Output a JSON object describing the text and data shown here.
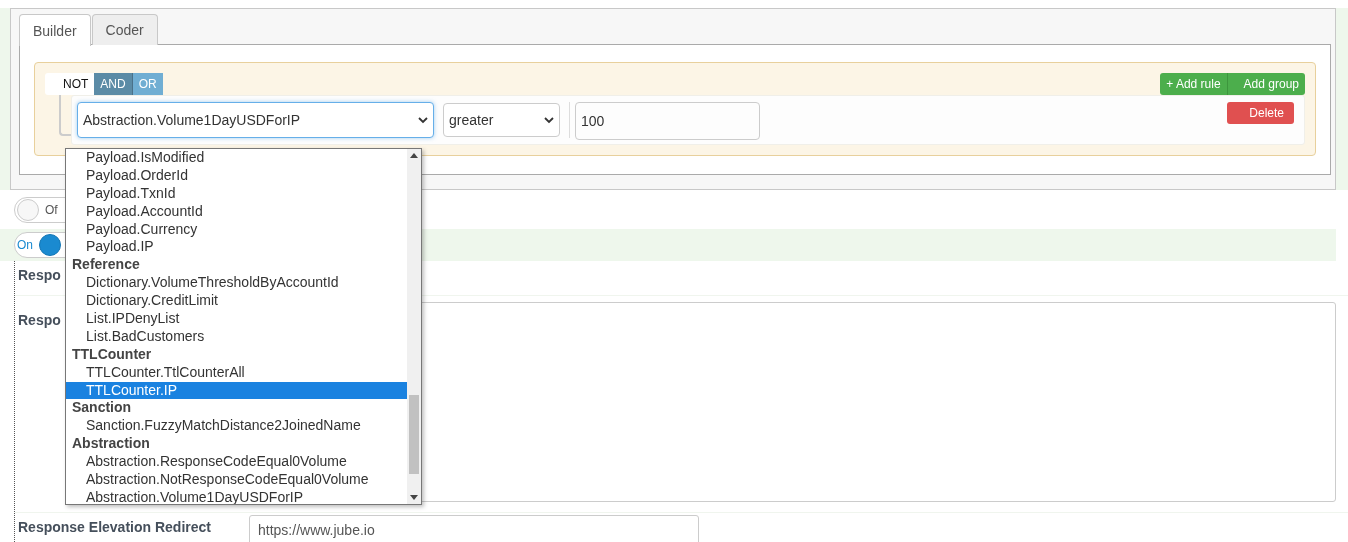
{
  "tabs": [
    {
      "label": "Builder",
      "selected": true
    },
    {
      "label": "Coder",
      "selected": false
    }
  ],
  "conditions": [
    {
      "label": "NOT",
      "selected": false
    },
    {
      "label": "AND",
      "selected": true
    },
    {
      "label": "OR",
      "selected": false
    }
  ],
  "group_actions": [
    {
      "icon": "+",
      "label": "Add rule"
    },
    {
      "label": "Add group"
    }
  ],
  "rule": {
    "field": "Abstraction.Volume1DayUSDForIP",
    "operator": "greater",
    "value": "100",
    "delete": "Delete"
  },
  "field_options": [
    {
      "kind": "option",
      "label": "Payload.IsModified",
      "selected": false
    },
    {
      "kind": "option",
      "label": "Payload.OrderId",
      "selected": false
    },
    {
      "kind": "option",
      "label": "Payload.TxnId",
      "selected": false
    },
    {
      "kind": "option",
      "label": "Payload.AccountId",
      "selected": false
    },
    {
      "kind": "option",
      "label": "Payload.Currency",
      "selected": false
    },
    {
      "kind": "option",
      "label": "Payload.IP",
      "selected": false
    },
    {
      "kind": "group",
      "label": "Reference"
    },
    {
      "kind": "option",
      "label": "Dictionary.VolumeThresholdByAccountId",
      "selected": false
    },
    {
      "kind": "option",
      "label": "Dictionary.CreditLimit",
      "selected": false
    },
    {
      "kind": "option",
      "label": "List.IPDenyList",
      "selected": false
    },
    {
      "kind": "option",
      "label": "List.BadCustomers",
      "selected": false
    },
    {
      "kind": "group",
      "label": "TTLCounter"
    },
    {
      "kind": "option",
      "label": "TTLCounter.TtlCounterAll",
      "selected": false
    },
    {
      "kind": "option",
      "label": "TTLCounter.IP",
      "selected": true
    },
    {
      "kind": "group",
      "label": "Sanction"
    },
    {
      "kind": "option",
      "label": "Sanction.FuzzyMatchDistance2JoinedName",
      "selected": false
    },
    {
      "kind": "group",
      "label": "Abstraction"
    },
    {
      "kind": "option",
      "label": "Abstraction.ResponseCodeEqual0Volume",
      "selected": false
    },
    {
      "kind": "option",
      "label": "Abstraction.NotResponseCodeEqual0Volume",
      "selected": false
    },
    {
      "kind": "option",
      "label": "Abstraction.Volume1DayUSDForIP",
      "selected": false
    }
  ],
  "toggles": [
    {
      "label": "Of",
      "on": false
    },
    {
      "label": "On",
      "on": true
    }
  ],
  "fields": [
    {
      "kind": "label",
      "label": "Respo"
    },
    {
      "kind": "textarea",
      "label": "Respo"
    },
    {
      "kind": "input",
      "label": "Response Elevation Redirect",
      "value": "https://www.jube.io"
    }
  ]
}
